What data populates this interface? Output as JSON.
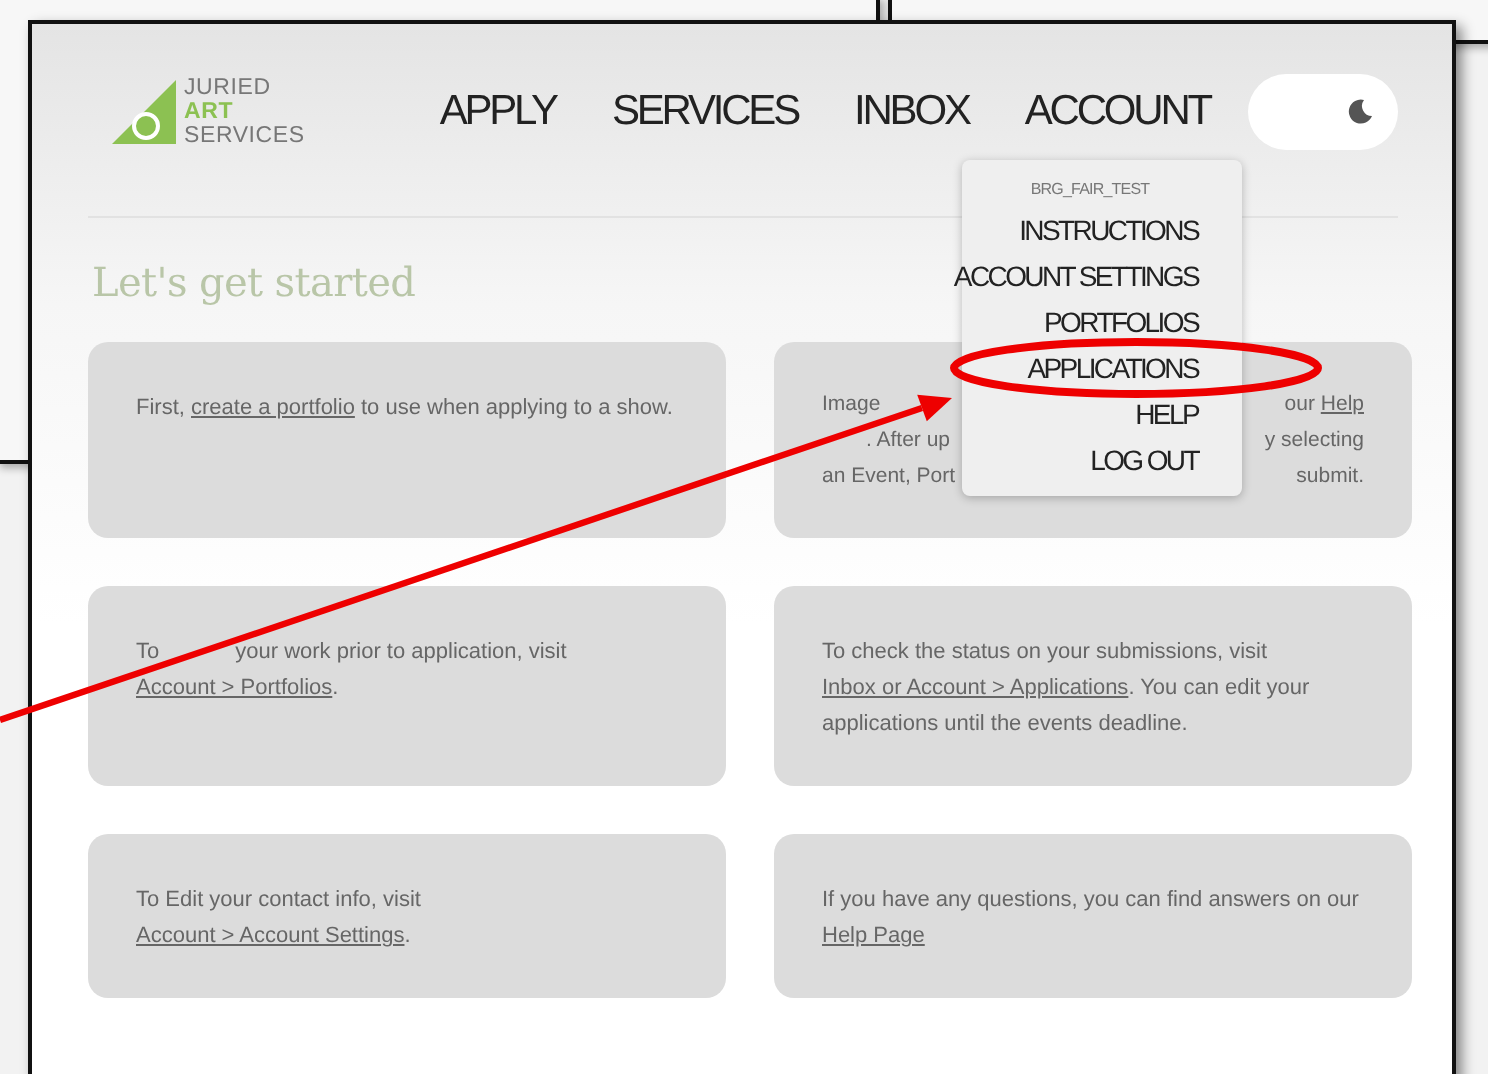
{
  "logo": {
    "lines": [
      {
        "text": "JURIED",
        "accent": false
      },
      {
        "text": "ART",
        "accent": true
      },
      {
        "text": "SERVICES",
        "accent": false
      }
    ]
  },
  "nav": [
    {
      "label": "APPLY"
    },
    {
      "label": "SERVICES"
    },
    {
      "label": "INBOX"
    },
    {
      "label": "ACCOUNT"
    }
  ],
  "account_menu": {
    "username": "BRG_FAIR_TEST",
    "items": [
      "INSTRUCTIONS",
      "ACCOUNT SETTINGS",
      "PORTFOLIOS",
      "APPLICATIONS",
      "HELP",
      "LOG OUT"
    ]
  },
  "theme_toggle": {
    "on": false
  },
  "heading": "Let's get started",
  "cards": [
    {
      "kind": "text",
      "segments": [
        {
          "text": "First, ",
          "link": false
        },
        {
          "text": "create a portfolio",
          "link": true
        },
        {
          "text": " to use when applying to a show.",
          "link": false
        }
      ]
    },
    {
      "kind": "covered",
      "lines": [
        {
          "left": [
            {
              "text": "Image",
              "link": false
            }
          ],
          "right": [
            {
              "text": "our ",
              "link": false
            },
            {
              "text": "Help",
              "link": true
            }
          ]
        },
        {
          "left": [
            {
              "text": ". After up",
              "link": false,
              "gap_before": true
            }
          ],
          "right": [
            {
              "text": "y selecting",
              "link": false
            }
          ]
        },
        {
          "left": [
            {
              "text": "an Event, Port",
              "link": false
            }
          ],
          "right": [
            {
              "text": "submit.",
              "link": false
            }
          ]
        }
      ]
    },
    {
      "kind": "text",
      "segments": [
        {
          "text": "To",
          "link": false
        },
        {
          "text": "your work prior to application, visit ",
          "link": false,
          "gap_before": true
        },
        {
          "text": "Account > Portfolios",
          "link": true
        },
        {
          "text": ".",
          "link": false
        }
      ]
    },
    {
      "kind": "text",
      "segments": [
        {
          "text": "To check the status on your submissions, visit ",
          "link": false
        },
        {
          "text": "Inbox or Account > Applications",
          "link": true
        },
        {
          "text": ". You can edit your applications until the events deadline.",
          "link": false
        }
      ]
    },
    {
      "kind": "text",
      "segments": [
        {
          "text": "To Edit your contact info, visit ",
          "link": false
        },
        {
          "text": "Account > Account Settings",
          "link": true
        },
        {
          "text": ".",
          "link": false
        }
      ]
    },
    {
      "kind": "text",
      "segments": [
        {
          "text": "If you have any questions, you can find answers on our ",
          "link": false
        },
        {
          "text": "Help Page",
          "link": true
        }
      ]
    }
  ]
}
